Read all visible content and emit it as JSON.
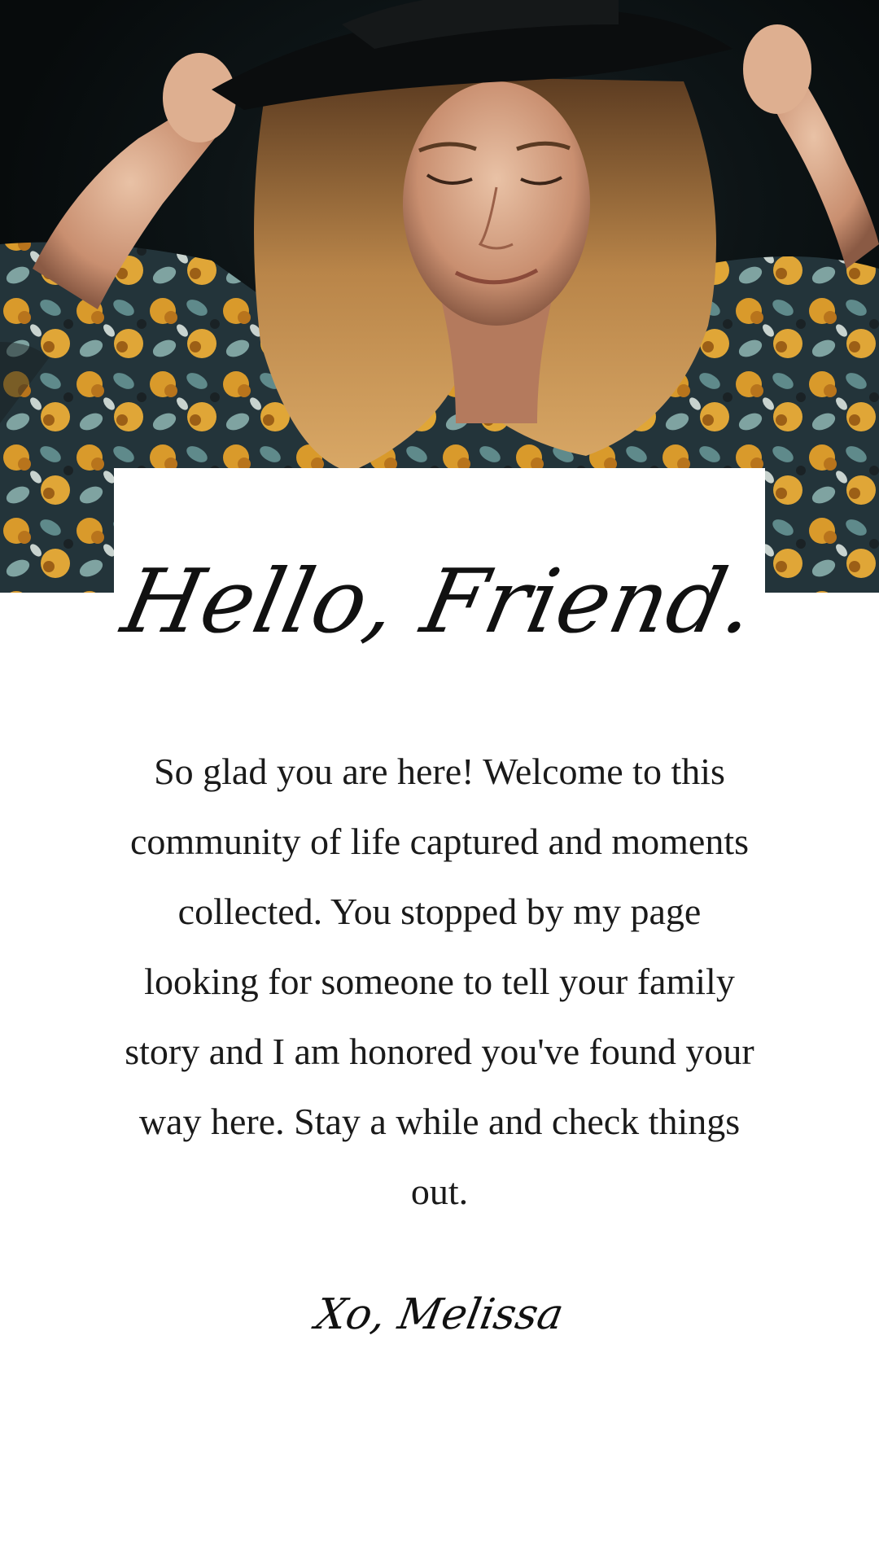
{
  "hero": {
    "image_label": "photo-of-woman-in-hat"
  },
  "card": {
    "greeting": "Hello, Friend.",
    "intro": "So glad you are here! Welcome to this community of life captured and moments collected. You stopped by my page looking for someone to tell your family story and I am honored you've found your way here. Stay a while and check things out.",
    "signature": "Xo, Melissa"
  },
  "colors": {
    "background": "#ffffff",
    "text": "#1a1a1a",
    "photo_dark": "#0d1416",
    "floral_mustard": "#d99a2b",
    "floral_teal": "#5f8a8b"
  }
}
